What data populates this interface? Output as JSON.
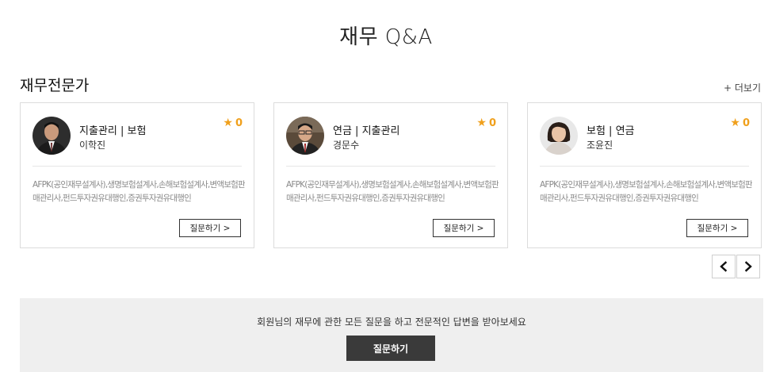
{
  "page": {
    "title": "재무 Q&A"
  },
  "experts_section": {
    "title": "재무전문가",
    "more_label": "+ 더보기"
  },
  "experts": [
    {
      "specialty": "지출관리 | 보험",
      "name": "이학진",
      "rating": "0",
      "qualifications": "AFPK(공인재무설계사),생명보험설계사,손해보험설계사,변액보험판매관리사,펀드투자권유대행인,증권투자권유대행인",
      "ask_label": "질문하기 >",
      "avatar": "male-suit-avatar"
    },
    {
      "specialty": "연금 | 지출관리",
      "name": "경문수",
      "rating": "0",
      "qualifications": "AFPK(공인재무설계사),생명보험설계사,손해보험설계사,변액보험판매관리사,펀드투자권유대행인,증권투자권유대행인",
      "ask_label": "질문하기 >",
      "avatar": "male-glasses-avatar"
    },
    {
      "specialty": "보험 | 연금",
      "name": "조윤진",
      "rating": "0",
      "qualifications": "AFPK(공인재무설계사),생명보험설계사,손해보험설계사,변액보험판매관리사,펀드투자권유대행인,증권투자권유대행인",
      "ask_label": "질문하기 >",
      "avatar": "female-avatar"
    }
  ],
  "pagination": {
    "prev_icon": "chevron-left-icon",
    "next_icon": "chevron-right-icon"
  },
  "banner": {
    "text": "회원님의 재무에 관한 모든 질문을 하고 전문적인 답변을 받아보세요",
    "button_label": "질문하기"
  },
  "colors": {
    "accent_star": "#f0a01c",
    "banner_bg": "#efefef",
    "button_dark": "#3a3a3a"
  }
}
